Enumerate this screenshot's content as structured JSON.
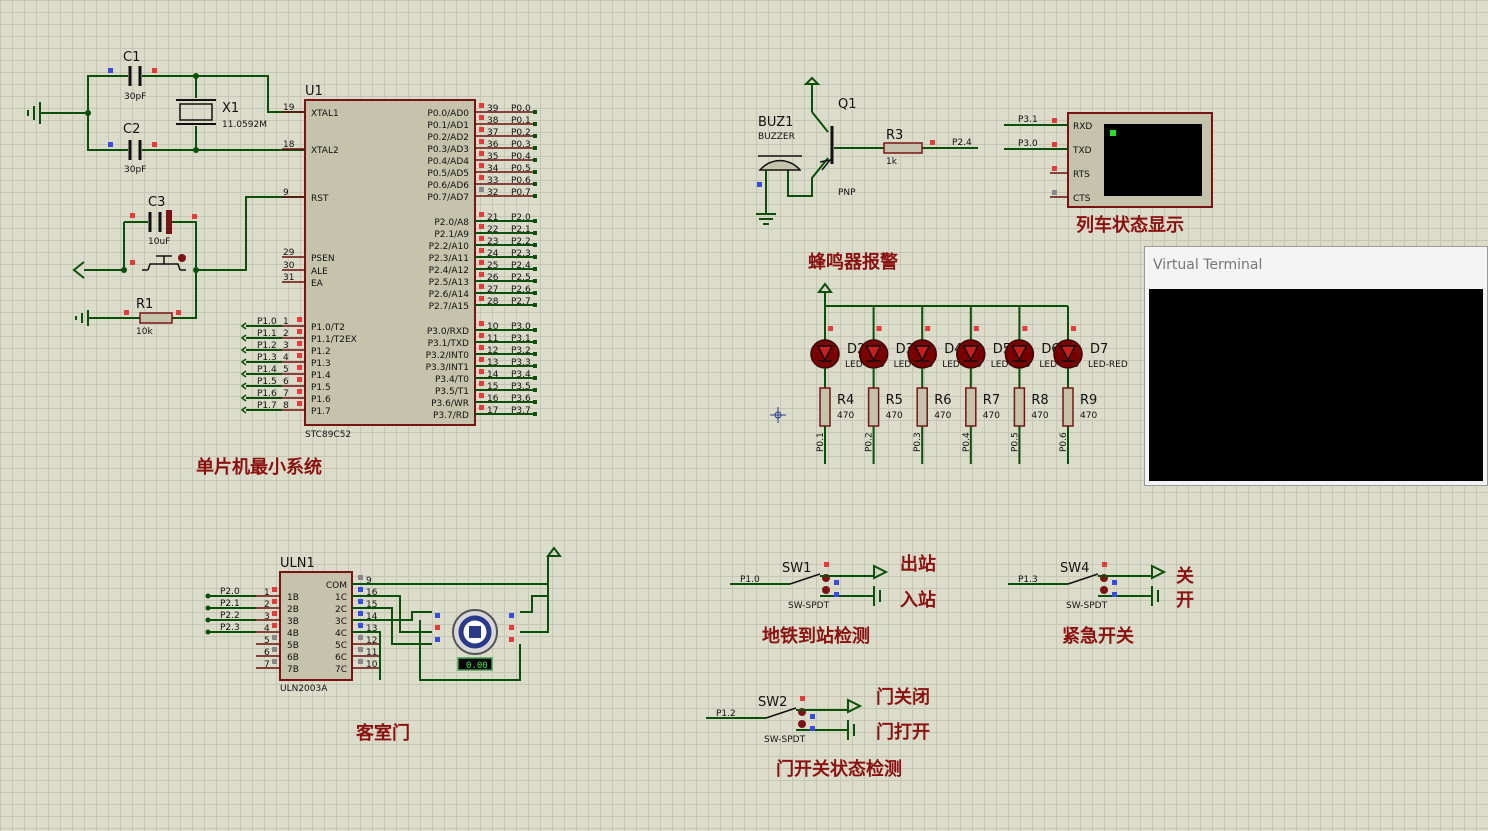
{
  "sections": {
    "mcu": "单片机最小系统",
    "buzzer": "蜂鸣器报警",
    "terminal": "列车状态显示",
    "door_motor": "客室门",
    "metro": "地铁到站检测",
    "emergency": "紧急开关",
    "door_state": "门开关状态检测"
  },
  "notes": {
    "sw1_a": "出站",
    "sw1_b": "入站",
    "sw4_a": "关",
    "sw4_b": "开",
    "sw2_a": "门关闭",
    "sw2_b": "门打开"
  },
  "mcu": {
    "ref": "U1",
    "part": "STC89C52",
    "left_pins": [
      {
        "num": "19",
        "name": "XTAL1"
      },
      {
        "num": "18",
        "name": "XTAL2"
      },
      {
        "num": "9",
        "name": "RST"
      },
      {
        "num": "29",
        "name": "PSEN"
      },
      {
        "num": "30",
        "name": "ALE"
      },
      {
        "num": "31",
        "name": "EA"
      },
      {
        "num": "1",
        "name": "P1.0/T2"
      },
      {
        "num": "2",
        "name": "P1.1/T2EX"
      },
      {
        "num": "3",
        "name": "P1.2"
      },
      {
        "num": "4",
        "name": "P1.3"
      },
      {
        "num": "5",
        "name": "P1.4"
      },
      {
        "num": "6",
        "name": "P1.5"
      },
      {
        "num": "7",
        "name": "P1.6"
      },
      {
        "num": "8",
        "name": "P1.7"
      }
    ],
    "left_nets": [
      "P1.0",
      "P1.1",
      "P1.2",
      "P1.3",
      "P1.4",
      "P1.5",
      "P1.6",
      "P1.7"
    ],
    "right_pins": [
      {
        "num": "39",
        "name": "P0.0/AD0",
        "net": "P0.0"
      },
      {
        "num": "38",
        "name": "P0.1/AD1",
        "net": "P0.1"
      },
      {
        "num": "37",
        "name": "P0.2/AD2",
        "net": "P0.2"
      },
      {
        "num": "36",
        "name": "P0.3/AD3",
        "net": "P0.3"
      },
      {
        "num": "35",
        "name": "P0.4/AD4",
        "net": "P0.4"
      },
      {
        "num": "34",
        "name": "P0.5/AD5",
        "net": "P0.5"
      },
      {
        "num": "33",
        "name": "P0.6/AD6",
        "net": "P0.6"
      },
      {
        "num": "32",
        "name": "P0.7/AD7",
        "net": "P0.7"
      },
      {
        "num": "21",
        "name": "P2.0/A8",
        "net": "P2.0"
      },
      {
        "num": "22",
        "name": "P2.1/A9",
        "net": "P2.1"
      },
      {
        "num": "23",
        "name": "P2.2/A10",
        "net": "P2.2"
      },
      {
        "num": "24",
        "name": "P2.3/A11",
        "net": "P2.3"
      },
      {
        "num": "25",
        "name": "P2.4/A12",
        "net": "P2.4"
      },
      {
        "num": "26",
        "name": "P2.5/A13",
        "net": "P2.5"
      },
      {
        "num": "27",
        "name": "P2.6/A14",
        "net": "P2.6"
      },
      {
        "num": "28",
        "name": "P2.7/A15",
        "net": "P2.7"
      },
      {
        "num": "10",
        "name": "P3.0/RXD",
        "net": "P3.0"
      },
      {
        "num": "11",
        "name": "P3.1/TXD",
        "net": "P3.1"
      },
      {
        "num": "12",
        "name": "P3.2/INT0",
        "net": "P3.2"
      },
      {
        "num": "13",
        "name": "P3.3/INT1",
        "net": "P3.3"
      },
      {
        "num": "14",
        "name": "P3.4/T0",
        "net": "P3.4"
      },
      {
        "num": "15",
        "name": "P3.5/T1",
        "net": "P3.5"
      },
      {
        "num": "16",
        "name": "P3.6/WR",
        "net": "P3.6"
      },
      {
        "num": "17",
        "name": "P3.7/RD",
        "net": "P3.7"
      }
    ]
  },
  "osc": {
    "c1": {
      "ref": "C1",
      "value": "30pF"
    },
    "c2": {
      "ref": "C2",
      "value": "30pF"
    },
    "x1": {
      "ref": "X1",
      "value": "11.0592M"
    },
    "c3": {
      "ref": "C3",
      "value": "10uF"
    },
    "r1": {
      "ref": "R1",
      "value": "10k"
    }
  },
  "buzzer": {
    "buz": {
      "ref": "BUZ1",
      "part": "BUZZER"
    },
    "q1": {
      "ref": "Q1",
      "part": "PNP"
    },
    "r3": {
      "ref": "R3",
      "value": "1k"
    },
    "net": "P2.4"
  },
  "terminal": {
    "pins": [
      "RXD",
      "TXD",
      "RTS",
      "CTS"
    ],
    "nets": [
      "P3.1",
      "P3.0"
    ]
  },
  "leds": [
    {
      "ref": "D2",
      "part": "LED-RED",
      "r": "R4",
      "rv": "470",
      "net": "P0.1"
    },
    {
      "ref": "D3",
      "part": "LED-RED",
      "r": "R5",
      "rv": "470",
      "net": "P0.2"
    },
    {
      "ref": "D4",
      "part": "LED-RED",
      "r": "R6",
      "rv": "470",
      "net": "P0.3"
    },
    {
      "ref": "D5",
      "part": "LED-RED",
      "r": "R7",
      "rv": "470",
      "net": "P0.4"
    },
    {
      "ref": "D6",
      "part": "LED-RED",
      "r": "R8",
      "rv": "470",
      "net": "P0.5"
    },
    {
      "ref": "D7",
      "part": "LED-RED",
      "r": "R9",
      "rv": "470",
      "net": "P0.6"
    }
  ],
  "uln": {
    "ref": "ULN1",
    "part": "ULN2003A",
    "in_pins": [
      {
        "num": "1",
        "name": "1B",
        "net": "P2.0"
      },
      {
        "num": "2",
        "name": "2B",
        "net": "P2.1"
      },
      {
        "num": "3",
        "name": "3B",
        "net": "P2.2"
      },
      {
        "num": "4",
        "name": "4B",
        "net": "P2.3"
      },
      {
        "num": "5",
        "name": "5B",
        "net": ""
      },
      {
        "num": "6",
        "name": "6B",
        "net": ""
      },
      {
        "num": "7",
        "name": "7B",
        "net": ""
      }
    ],
    "out_pins": [
      {
        "num": "9",
        "name": "COM"
      },
      {
        "num": "16",
        "name": "1C"
      },
      {
        "num": "15",
        "name": "2C"
      },
      {
        "num": "14",
        "name": "3C"
      },
      {
        "num": "13",
        "name": "4C"
      },
      {
        "num": "12",
        "name": "5C"
      },
      {
        "num": "11",
        "name": "6C"
      },
      {
        "num": "10",
        "name": "7C"
      }
    ],
    "motor_readout": "0.00"
  },
  "switches": {
    "sw1": {
      "ref": "SW1",
      "part": "SW-SPDT",
      "net": "P1.0"
    },
    "sw4": {
      "ref": "SW4",
      "part": "SW-SPDT",
      "net": "P1.3"
    },
    "sw2": {
      "ref": "SW2",
      "part": "SW-SPDT",
      "net": "P1.2"
    }
  },
  "virtual_terminal": {
    "title": "Virtual Terminal"
  },
  "colors": {
    "wire": "#0a4f0a",
    "component": "#7a1414",
    "label": "#8b1010",
    "background": "#dcdccb",
    "terminal": "#000000"
  }
}
